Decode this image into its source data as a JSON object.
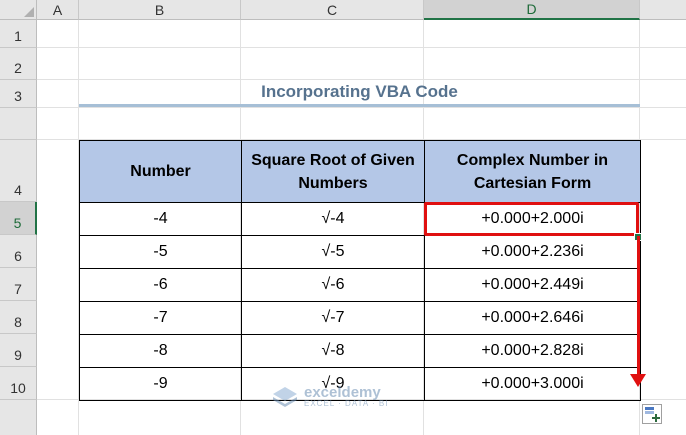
{
  "columns": [
    "A",
    "B",
    "C",
    "D"
  ],
  "rows": [
    "1",
    "2",
    "3",
    "4",
    "5",
    "6",
    "7",
    "8",
    "9",
    "10"
  ],
  "title": "Incorporating VBA Code",
  "table": {
    "headers": [
      "Number",
      "Square Root of Given Numbers",
      "Complex Number in Cartesian Form"
    ],
    "rows": [
      [
        "-4",
        "√-4",
        "+0.000+2.000i"
      ],
      [
        "-5",
        "√-5",
        "+0.000+2.236i"
      ],
      [
        "-6",
        "√-6",
        "+0.000+2.449i"
      ],
      [
        "-7",
        "√-7",
        "+0.000+2.646i"
      ],
      [
        "-8",
        "√-8",
        "+0.000+2.828i"
      ],
      [
        "-9",
        "√-9",
        "+0.000+3.000i"
      ]
    ]
  },
  "watermark": {
    "name": "exceldemy",
    "tagline": "EXCEL · DATA · BI"
  },
  "colors": {
    "header_fill": "#b4c7e7",
    "title_text": "#56728e",
    "highlight": "#e01010",
    "excel_green": "#217346"
  }
}
